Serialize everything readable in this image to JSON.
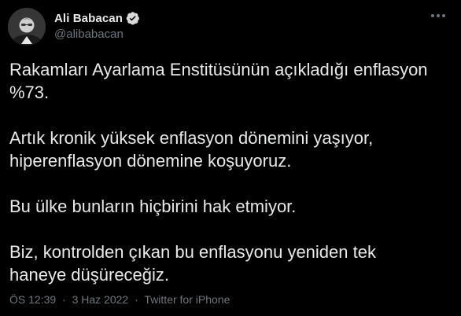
{
  "author": {
    "display_name": "Ali Babacan",
    "handle": "@alibabacan",
    "verified": true
  },
  "tweet": {
    "paragraphs": [
      "Rakamları Ayarlama Enstitüsünün açıkladığı enflasyon\n%73.",
      "Artık kronik yüksek enflasyon dönemini yaşıyor,\nhiperenflasyon dönemine koşuyoruz.",
      "Bu ülke bunların hiçbirini hak etmiyor.",
      "Biz, kontrolden çıkan bu enflasyonu yeniden tek\nhaneye düşüreceğiz."
    ]
  },
  "meta": {
    "time": "ÖS 12:39",
    "separator": "·",
    "date": "3 Haz 2022",
    "source": "Twitter for iPhone"
  },
  "colors": {
    "background": "#000000",
    "text": "#e7e9ea",
    "secondary": "#6e767d",
    "verified_badge": "#d9d9d9"
  },
  "icons": {
    "verified": "verified-badge-icon",
    "more": "more-options-icon"
  }
}
